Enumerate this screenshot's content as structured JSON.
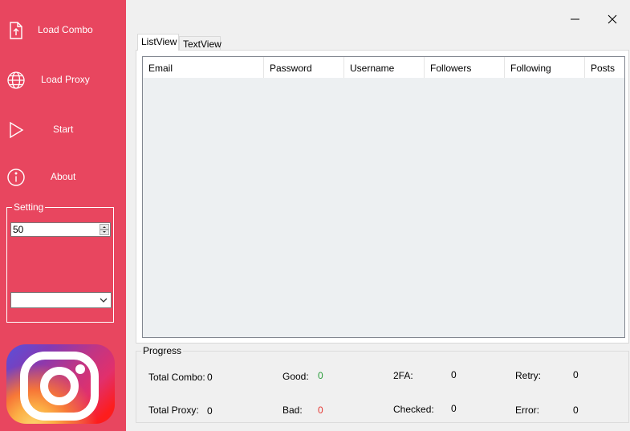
{
  "sidebar": {
    "items": [
      {
        "label": "Load Combo",
        "icon": "upload-file-icon"
      },
      {
        "label": "Load Proxy",
        "icon": "globe-icon"
      },
      {
        "label": "Start",
        "icon": "play-icon"
      },
      {
        "label": "About",
        "icon": "info-icon"
      }
    ],
    "settings": {
      "legend": "Setting",
      "threads_value": "50",
      "dropdown_value": ""
    },
    "logo": "instagram-logo"
  },
  "window": {
    "minimize_icon": "minimize-icon",
    "close_icon": "close-icon"
  },
  "tabs": [
    {
      "label": "ListView",
      "active": true
    },
    {
      "label": "TextView",
      "active": false
    }
  ],
  "listview": {
    "columns": [
      "Email",
      "Password",
      "Username",
      "Followers",
      "Following",
      "Posts"
    ],
    "rows": []
  },
  "progress": {
    "legend": "Progress",
    "stats": {
      "total_combo": {
        "label": "Total Combo:",
        "value": "0"
      },
      "total_proxy": {
        "label": "Total Proxy:",
        "value": "0"
      },
      "good": {
        "label": "Good:",
        "value": "0"
      },
      "bad": {
        "label": "Bad:",
        "value": "0"
      },
      "twofa": {
        "label": "2FA:",
        "value": "0"
      },
      "checked": {
        "label": "Checked:",
        "value": "0"
      },
      "retry": {
        "label": "Retry:",
        "value": "0"
      },
      "error": {
        "label": "Error:",
        "value": "0"
      }
    }
  },
  "colors": {
    "sidebar": "#e8465f",
    "good": "#2a9d3a",
    "bad": "#e53935"
  }
}
